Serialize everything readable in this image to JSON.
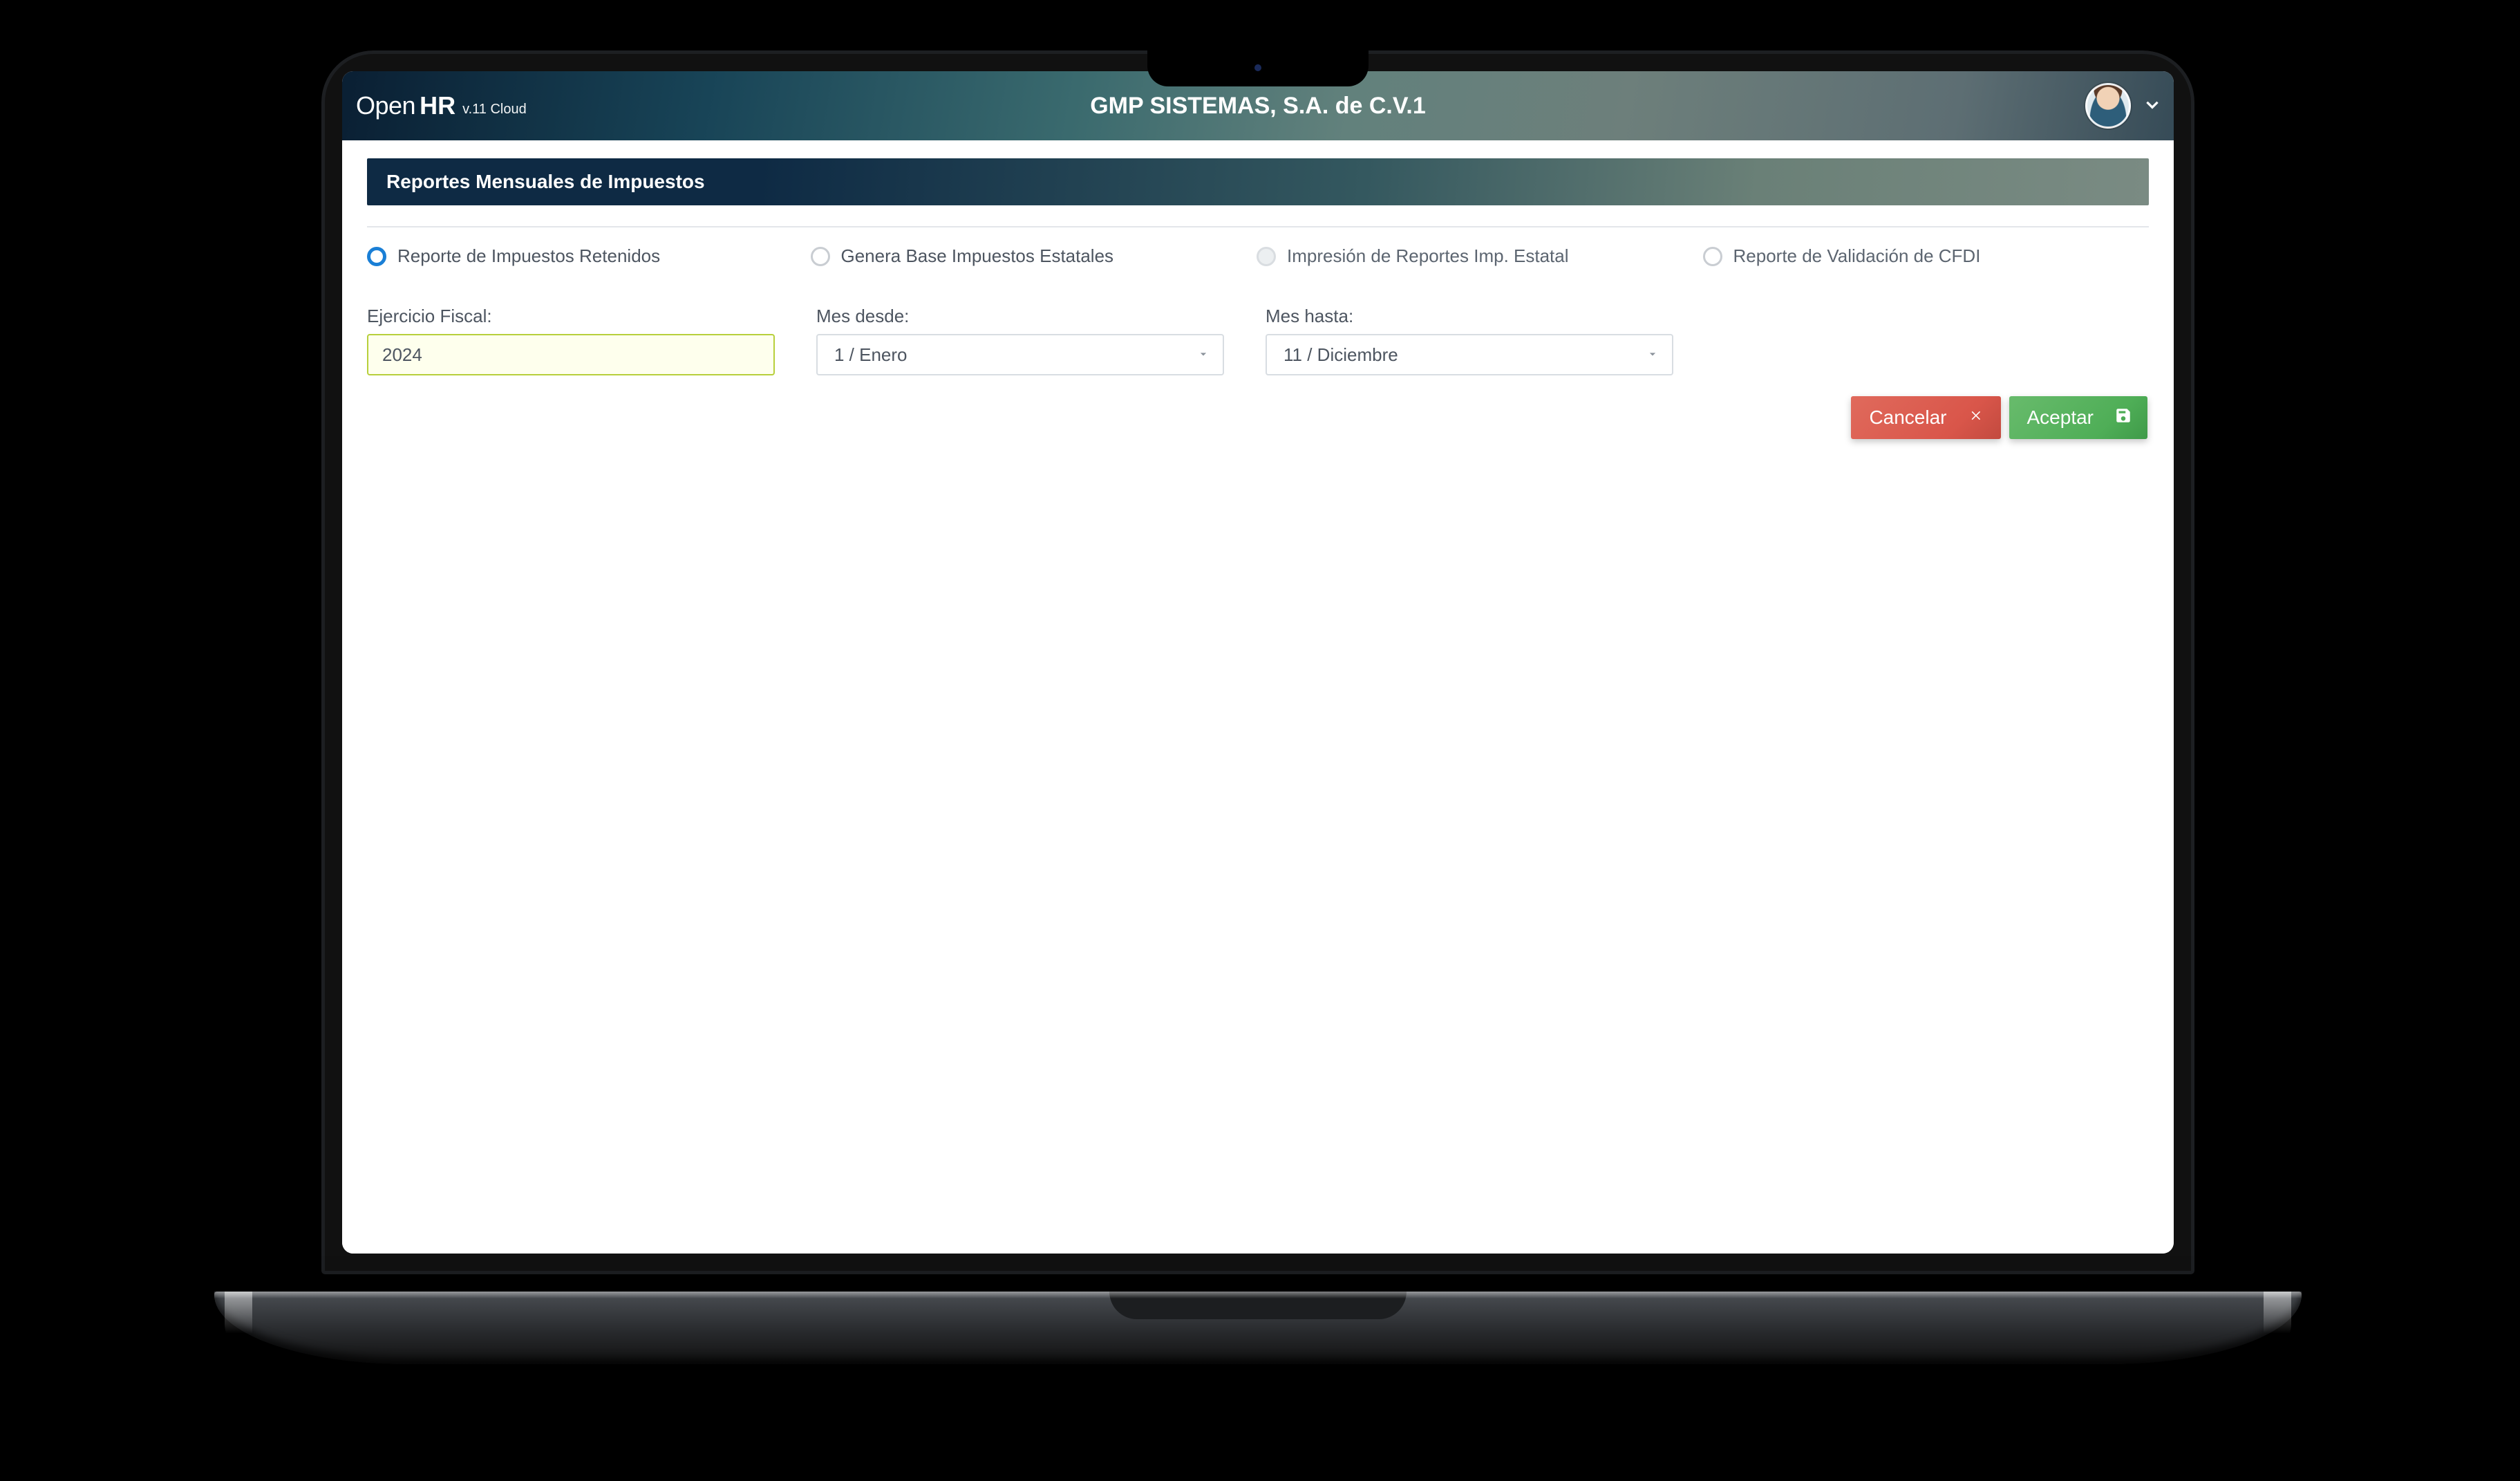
{
  "brand": {
    "name_part1": "Open",
    "name_part2": "HR",
    "version": "v.11 Cloud"
  },
  "header": {
    "company": "GMP SISTEMAS, S.A. de C.V.1"
  },
  "section": {
    "title": "Reportes Mensuales de Impuestos"
  },
  "options": {
    "opt1": "Reporte de Impuestos Retenidos",
    "opt2": "Genera Base Impuestos Estatales",
    "opt3": "Impresión de Reportes Imp. Estatal",
    "opt4": "Reporte de Validación de CFDI"
  },
  "fields": {
    "year_label": "Ejercicio Fiscal:",
    "year_value": "2024",
    "from_label": "Mes desde:",
    "from_value": "1 / Enero",
    "to_label": "Mes hasta:",
    "to_value": "11 / Diciembre"
  },
  "actions": {
    "cancel": "Cancelar",
    "accept": "Aceptar"
  }
}
